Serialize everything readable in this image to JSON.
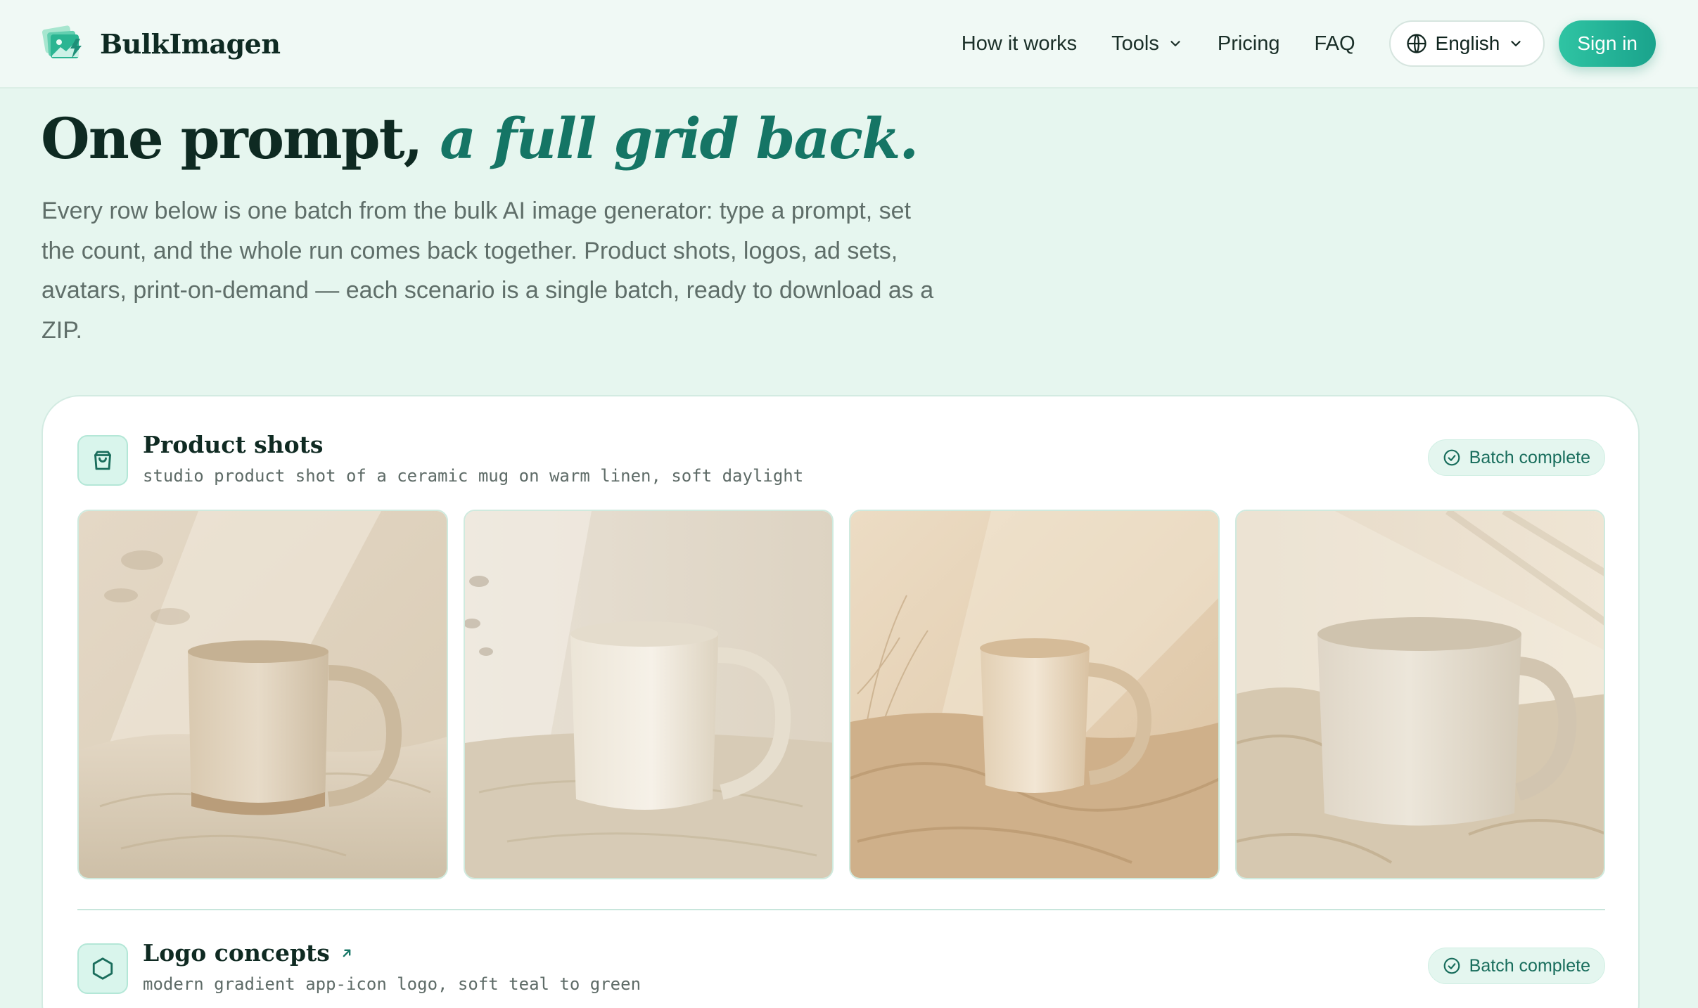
{
  "header": {
    "brand": "BulkImagen",
    "nav": [
      "How it works",
      "Tools",
      "Pricing",
      "FAQ"
    ],
    "language": "English",
    "signin": "Sign in"
  },
  "hero": {
    "title_main": "One prompt,",
    "title_accent": "a full grid back.",
    "description": "Every row below is one batch from the bulk AI image generator: type a prompt, set the count, and the whole run comes back together. Product shots, logos, ad sets, avatars, print-on-demand — each scenario is a single batch, ready to download as a ZIP."
  },
  "rows": [
    {
      "title": "Product shots",
      "prompt": "studio product shot of a ceramic mug on warm linen, soft daylight",
      "status": "Batch complete",
      "icon": "shopping-bag-icon",
      "images": [
        "ceramic mug on linen 1",
        "ceramic mug on linen 2",
        "ceramic mug on linen 3",
        "ceramic mug on linen 4"
      ]
    },
    {
      "title": "Logo concepts",
      "prompt": "modern gradient app-icon logo, soft teal to green",
      "status": "Batch complete",
      "icon": "hexagon-icon"
    }
  ],
  "colors": {
    "accent": "#157565",
    "brand_teal": "#2fc4a3",
    "background": "#e6f6ef"
  }
}
